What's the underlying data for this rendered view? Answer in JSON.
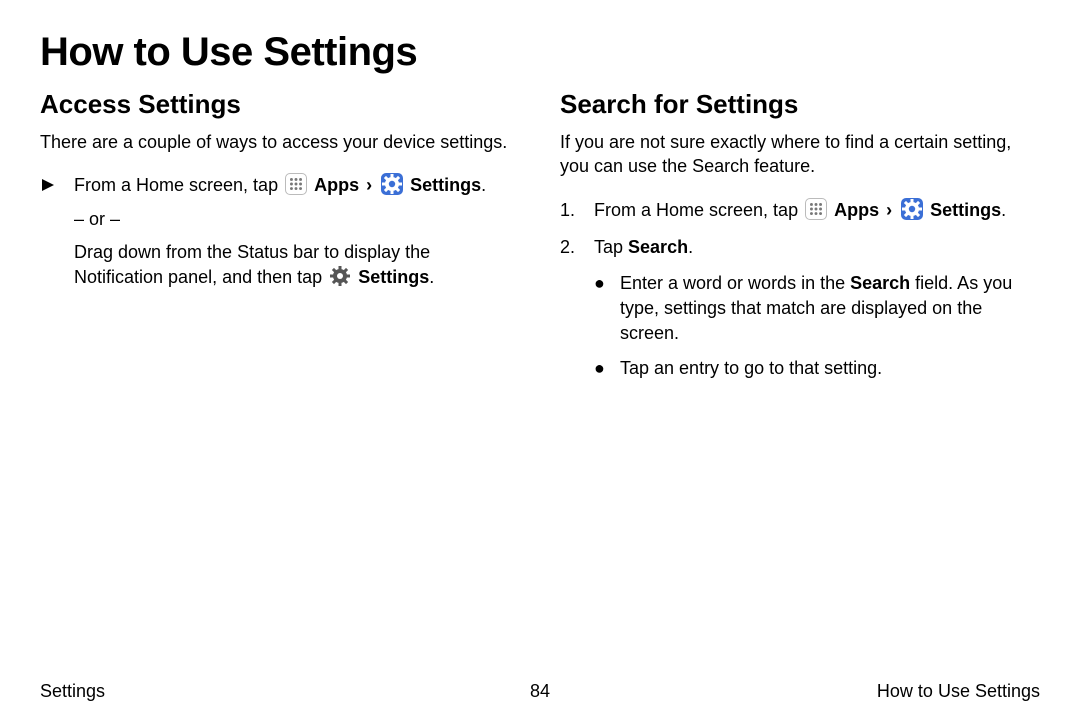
{
  "title": "How to Use Settings",
  "left": {
    "heading": "Access Settings",
    "intro": "There are a couple of ways to access your device settings.",
    "step_prefix": "From a Home screen, tap ",
    "apps_label": "Apps",
    "settings_label": "Settings",
    "or_text": "– or –",
    "alt_prefix": "Drag down from the Status bar to display the Notification panel, and then tap ",
    "alt_settings_label": "Settings"
  },
  "right": {
    "heading": "Search for Settings",
    "intro": "If you are not sure exactly where to find a certain setting, you can use the Search feature.",
    "step1_num": "1.",
    "step1_prefix": "From a Home screen, tap ",
    "apps_label": "Apps",
    "settings_label": "Settings",
    "step2_num": "2.",
    "step2_prefix": "Tap ",
    "step2_bold": "Search",
    "bullet1_prefix": "Enter a word or words in the ",
    "bullet1_bold": "Search",
    "bullet1_suffix": " field. As you type, settings that match are displayed on the screen.",
    "bullet2": "Tap an entry to go to that setting."
  },
  "footer": {
    "left": "Settings",
    "center": "84",
    "right": "How to Use Settings"
  }
}
